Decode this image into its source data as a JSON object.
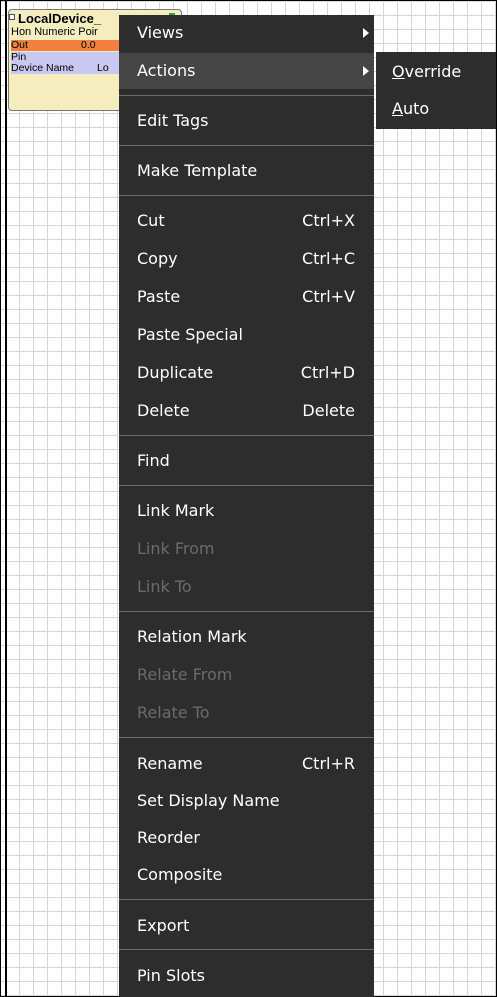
{
  "node": {
    "title": "LocalDevice_",
    "subtitle": "Hon Numeric Poir",
    "slots": [
      {
        "name": "Out",
        "value": "0.0"
      },
      {
        "name": "Pin",
        "value": ""
      },
      {
        "name": "Device Name",
        "value": "Lo"
      }
    ]
  },
  "menu": {
    "views": "Views",
    "actions": "Actions",
    "edit_tags": "Edit Tags",
    "make_template": "Make Template",
    "cut": "Cut",
    "cut_sc": "Ctrl+X",
    "copy": "Copy",
    "copy_sc": "Ctrl+C",
    "paste": "Paste",
    "paste_sc": "Ctrl+V",
    "paste_special": "Paste Special",
    "duplicate": "Duplicate",
    "duplicate_sc": "Ctrl+D",
    "delete": "Delete",
    "delete_sc": "Delete",
    "find": "Find",
    "link_mark": "Link Mark",
    "link_from": "Link From",
    "link_to": "Link To",
    "relation_mark": "Relation Mark",
    "relate_from": "Relate From",
    "relate_to": "Relate To",
    "rename": "Rename",
    "rename_sc": "Ctrl+R",
    "set_display_name": "Set Display Name",
    "reorder": "Reorder",
    "composite": "Composite",
    "export": "Export",
    "pin_slots": "Pin Slots"
  },
  "submenu": {
    "override_mnemonic": "O",
    "override_rest": "verride",
    "auto_mnemonic": "A",
    "auto_rest": "uto"
  },
  "colors": {
    "menu_bg": "#2d2d2d",
    "menu_highlight": "#454545",
    "disabled_text": "#6b6b6b",
    "out_slot": "#f08040",
    "slot_bg": "#c8c8f0",
    "node_bg": "#f4edbf"
  }
}
